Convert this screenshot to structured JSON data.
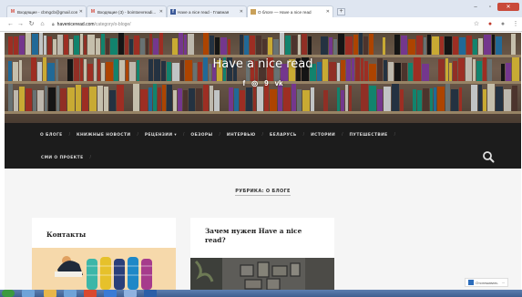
{
  "browser": {
    "tabs": [
      {
        "title": "Входящие - cbmgcb@gmail.com",
        "icon": "gmail-icon",
        "active": false
      },
      {
        "title": "Входящие (3) - bointoevreadi...",
        "icon": "gmail-icon",
        "active": false
      },
      {
        "title": "Have a nice read - Главная",
        "icon": "facebook-icon",
        "active": false
      },
      {
        "title": "О блоге — Have a nice read",
        "icon": "blog-icon",
        "active": true
      }
    ],
    "new_tab_label": "+",
    "address": {
      "host": "haveniceread.com",
      "path": "/category/o-bloge/",
      "lock_icon": "lock-icon"
    },
    "toolbar_icons": [
      "star-icon",
      "extension-icon",
      "profile-icon",
      "menu-icon"
    ]
  },
  "site": {
    "title": "Have a nice read",
    "social": [
      {
        "icon": "facebook-icon",
        "glyph": "f"
      },
      {
        "icon": "instagram-icon",
        "glyph": "◎"
      },
      {
        "icon": "odnoklassniki-icon",
        "glyph": "9"
      },
      {
        "icon": "vk-icon",
        "glyph": "vk"
      }
    ],
    "nav": [
      {
        "label": "О блоге",
        "dropdown": false
      },
      {
        "label": "Книжные новости",
        "dropdown": false
      },
      {
        "label": "Рецензии",
        "dropdown": true
      },
      {
        "label": "Обзоры",
        "dropdown": false
      },
      {
        "label": "Интервью",
        "dropdown": false
      },
      {
        "label": "Беларусь",
        "dropdown": false
      },
      {
        "label": "Истории",
        "dropdown": false
      },
      {
        "label": "Путешествие",
        "dropdown": false
      }
    ],
    "nav_row2": {
      "label": "СМИ о проекте"
    },
    "dropdown_glyph": "▾",
    "search_icon": "search-icon"
  },
  "content": {
    "rubric": "РУБРИКА: О БЛОГЕ",
    "cards": [
      {
        "title": "Контакты"
      },
      {
        "title": "Зачем нужен Have a nice read?"
      }
    ]
  },
  "badge": {
    "label": "Отслеживать",
    "more": "···"
  },
  "colors": {
    "nav_bg": "#1c1c1c",
    "content_bg": "#f5f5f5",
    "taskbar": "#4a6b9e",
    "close_btn": "#c94a3a"
  }
}
